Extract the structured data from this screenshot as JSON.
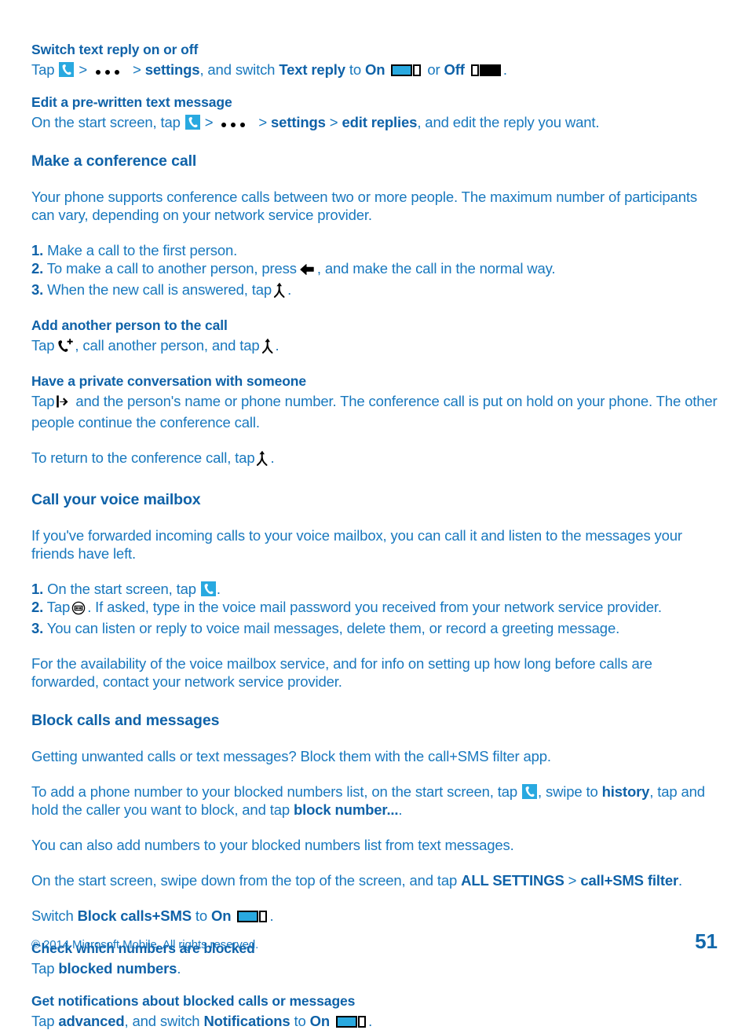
{
  "document": {
    "page_number": "51",
    "copyright": "© 2014 Microsoft Mobile. All rights reserved."
  },
  "sections": {
    "switch_text_reply": {
      "heading": "Switch text reply on or off",
      "line_tap": "Tap",
      "sep": ">",
      "settings": "settings",
      "and_switch": ", and switch",
      "text_reply": "Text reply",
      "to": "to",
      "on": "On",
      "or": "or",
      "off": "Off",
      "period": "."
    },
    "edit_prewritten": {
      "heading": "Edit a pre-written text message",
      "lead": "On the start screen, tap",
      "sep": ">",
      "settings": "settings",
      "sep2": ">",
      "edit_replies": "edit replies",
      "tail": ", and edit the reply you want."
    },
    "conference_call": {
      "heading": "Make a conference call",
      "intro": "Your phone supports conference calls between two or more people. The maximum number of participants can vary, depending on your network service provider.",
      "steps": [
        {
          "num": "1.",
          "text_before": "Make a call to the first person.",
          "icon": "",
          "text_after": ""
        },
        {
          "num": "2.",
          "text_before": "To make a call to another person, press",
          "icon": "back-arrow-icon",
          "text_after": ", and make the call in the normal way."
        },
        {
          "num": "3.",
          "text_before": "When the new call is answered, tap",
          "icon": "merge-calls-icon",
          "text_after": "."
        }
      ]
    },
    "add_person": {
      "heading": "Add another person to the call",
      "tap": "Tap",
      "mid": ", call another person, and tap",
      "end": "."
    },
    "private_conversation": {
      "heading": "Have a private conversation with someone",
      "tap": "Tap",
      "body": "and the person's name or phone number. The conference call is put on hold on your phone. The other people continue the conference call.",
      "return_line_before": "To return to the conference call, tap",
      "return_line_after": "."
    },
    "voice_mailbox": {
      "heading": "Call your voice mailbox",
      "intro": "If you've forwarded incoming calls to your voice mailbox, you can call it and listen to the messages your friends have left.",
      "steps": [
        {
          "num": "1.",
          "text_before": "On the start screen, tap",
          "icon": "phone-tile-icon",
          "text_after": "."
        },
        {
          "num": "2.",
          "text_before": "Tap",
          "icon": "voicemail-icon",
          "text_after": ". If asked, type in the voice mail password you received from your network service provider."
        },
        {
          "num": "3.",
          "text_before": "You can listen or reply to voice mail messages, delete them, or record a greeting message.",
          "icon": "",
          "text_after": ""
        }
      ],
      "outro": "For the availability of the voice mailbox service, and for info on setting up how long before calls are forwarded, contact your network service provider."
    },
    "block_calls": {
      "heading": "Block calls and messages",
      "intro": "Getting unwanted calls or text messages? Block them with the call+SMS filter app.",
      "add_number_before": "To add a phone number to your blocked numbers list, on the start screen, tap",
      "add_number_mid": ", swipe to",
      "history": "history",
      "add_number_after": ", tap and hold the caller you want to block, and tap",
      "block_number": "block number...",
      "period": ".",
      "also_add": "You can also add numbers to your blocked numbers list from text messages.",
      "settings_before": "On the start screen, swipe down from the top of the screen, and tap",
      "all_settings": "ALL SETTINGS",
      "sep": ">",
      "callsms_filter": "call+SMS filter",
      "settings_after": ".",
      "switch_before": "Switch",
      "block_callsms": "Block calls+SMS",
      "switch_to": "to",
      "on": "On",
      "switch_after": "."
    },
    "check_blocked": {
      "heading": "Check which numbers are blocked",
      "tap": "Tap",
      "blocked_numbers": "blocked numbers",
      "period": "."
    },
    "get_notifications": {
      "heading": "Get notifications about blocked calls or messages",
      "tap": "Tap",
      "advanced": "advanced",
      "mid": ", and switch",
      "notifications": "Notifications",
      "to": "to",
      "on": "On",
      "period": "."
    }
  },
  "colors": {
    "heading": "#0f62a8",
    "body": "#1878be",
    "accent_tile": "#29a9e0",
    "toggle_on": "#29a9e0",
    "toggle_off": "#000000"
  }
}
